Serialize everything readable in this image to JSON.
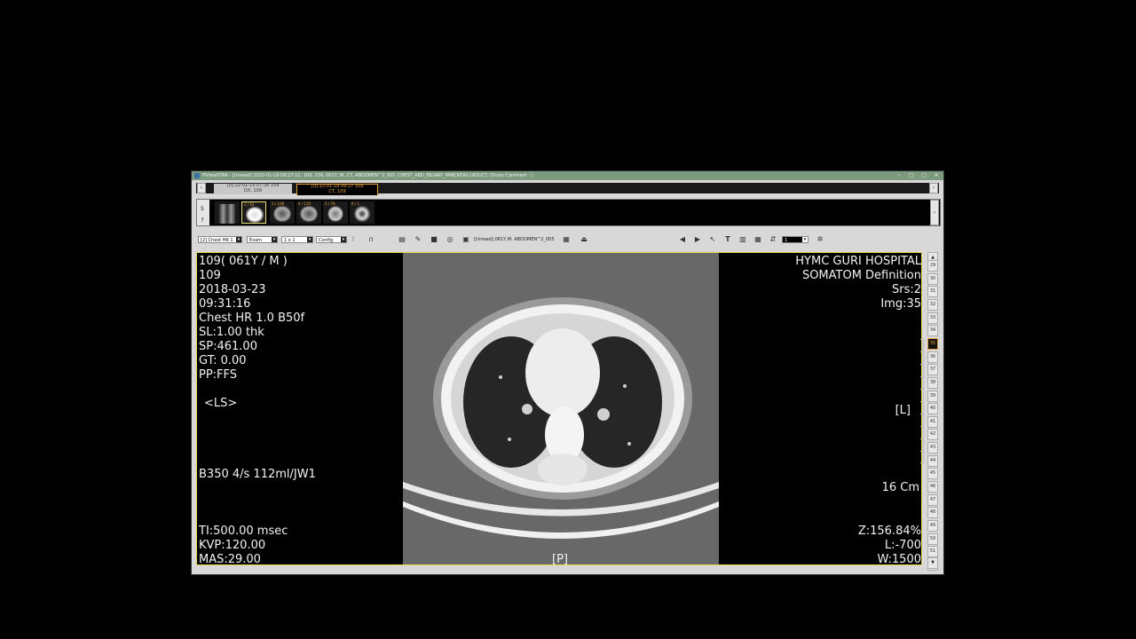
{
  "window": {
    "title": "PiViewSTAR - [Unread] 2022-01-19 09:27:11, 109, 109, 061Y, M, CT, ABDOMEN^2_005_CHEST_ABD_BILIARY_PANCREAS (ADULT)  (Study Comment : )",
    "controls": [
      "–",
      "□",
      "□",
      "✕"
    ]
  },
  "tabs": [
    {
      "line1": "[U] 22-01-19 07:38  109",
      "line2": "DX, 109"
    },
    {
      "line1": "[U] 22-01-19 09:27  109",
      "line2": "CT, 109"
    }
  ],
  "thumbs": [
    {
      "caption": ""
    },
    {
      "caption": "2 / 64"
    },
    {
      "caption": "3 / 108"
    },
    {
      "caption": "4 / 135"
    },
    {
      "caption": "5 / 78"
    },
    {
      "caption": "6 / 1"
    }
  ],
  "side_labels": {
    "s": "S",
    "f": "f"
  },
  "toolbar": {
    "series_select": "[2] Chest HR  1",
    "exam_select": "Exam",
    "layout_select": "1 x 1",
    "config_select": "Config.",
    "study_label": "[Unread] 061Y,M, ABDOMEN^2_005",
    "frame_select": "1"
  },
  "overlay": {
    "top_left": [
      "109( 061Y / M )",
      "109",
      "2018-03-23",
      "09:31:16",
      "Chest HR  1.0  B50f",
      "SL:1.00 thk",
      "SP:461.00",
      "GT: 0.00",
      "PP:FFS"
    ],
    "ls": "<LS>",
    "contrast": "B350 4/s 112ml/JW1",
    "bottom_left": [
      "TI:500.00 msec",
      "KVP:120.00",
      "MAS:29.00"
    ],
    "top_right": [
      "HYMC GURI HOSPITAL",
      "SOMATOM Definition",
      "Srs:2",
      "Img:35"
    ],
    "orient_right": "[L]",
    "scale": "16 Cm",
    "bottom_right": [
      "Z:156.84%",
      "L:-700",
      "W:1500"
    ],
    "orient_bottom": "[P]"
  },
  "image_pages": [
    "29",
    "30",
    "31",
    "32",
    "33",
    "34",
    "35",
    "36",
    "37",
    "38",
    "39",
    "40",
    "41",
    "42",
    "43",
    "44",
    "45",
    "46",
    "47",
    "48",
    "49",
    "50",
    "51",
    "52"
  ],
  "current_page": "35"
}
